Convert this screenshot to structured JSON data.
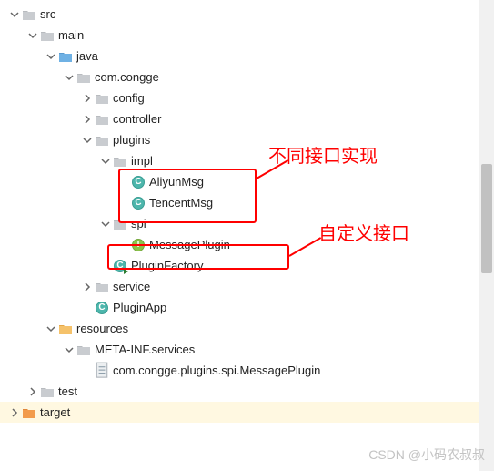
{
  "tree": {
    "src": "src",
    "main": "main",
    "java": "java",
    "com_congge": "com.congge",
    "config": "config",
    "controller": "controller",
    "plugins": "plugins",
    "impl": "impl",
    "aliyun": "AliyunMsg",
    "tencent": "TencentMsg",
    "spi": "spi",
    "message_plugin": "MessagePlugin",
    "plugin_factory": "PluginFactory",
    "service": "service",
    "plugin_app": "PluginApp",
    "resources": "resources",
    "meta_inf": "META-INF.services",
    "spi_file": "com.congge.plugins.spi.MessagePlugin",
    "test": "test",
    "target": "target"
  },
  "callouts": {
    "impl_note": "不同接口实现",
    "iface_note": "自定义接口"
  },
  "watermark": "CSDN @小码农叔叔"
}
